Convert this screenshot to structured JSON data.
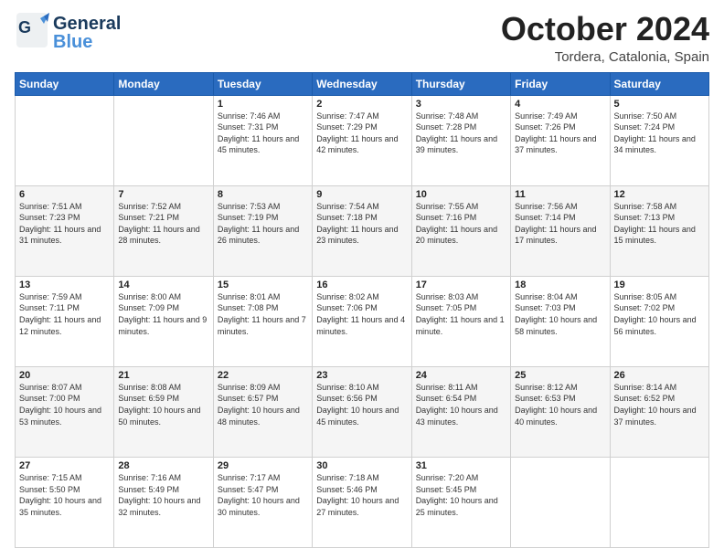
{
  "header": {
    "logo_general": "General",
    "logo_blue": "Blue",
    "month_title": "October 2024",
    "location": "Tordera, Catalonia, Spain"
  },
  "weekdays": [
    "Sunday",
    "Monday",
    "Tuesday",
    "Wednesday",
    "Thursday",
    "Friday",
    "Saturday"
  ],
  "weeks": [
    [
      {
        "day": "",
        "sunrise": "",
        "sunset": "",
        "daylight": ""
      },
      {
        "day": "",
        "sunrise": "",
        "sunset": "",
        "daylight": ""
      },
      {
        "day": "1",
        "sunrise": "Sunrise: 7:46 AM",
        "sunset": "Sunset: 7:31 PM",
        "daylight": "Daylight: 11 hours and 45 minutes."
      },
      {
        "day": "2",
        "sunrise": "Sunrise: 7:47 AM",
        "sunset": "Sunset: 7:29 PM",
        "daylight": "Daylight: 11 hours and 42 minutes."
      },
      {
        "day": "3",
        "sunrise": "Sunrise: 7:48 AM",
        "sunset": "Sunset: 7:28 PM",
        "daylight": "Daylight: 11 hours and 39 minutes."
      },
      {
        "day": "4",
        "sunrise": "Sunrise: 7:49 AM",
        "sunset": "Sunset: 7:26 PM",
        "daylight": "Daylight: 11 hours and 37 minutes."
      },
      {
        "day": "5",
        "sunrise": "Sunrise: 7:50 AM",
        "sunset": "Sunset: 7:24 PM",
        "daylight": "Daylight: 11 hours and 34 minutes."
      }
    ],
    [
      {
        "day": "6",
        "sunrise": "Sunrise: 7:51 AM",
        "sunset": "Sunset: 7:23 PM",
        "daylight": "Daylight: 11 hours and 31 minutes."
      },
      {
        "day": "7",
        "sunrise": "Sunrise: 7:52 AM",
        "sunset": "Sunset: 7:21 PM",
        "daylight": "Daylight: 11 hours and 28 minutes."
      },
      {
        "day": "8",
        "sunrise": "Sunrise: 7:53 AM",
        "sunset": "Sunset: 7:19 PM",
        "daylight": "Daylight: 11 hours and 26 minutes."
      },
      {
        "day": "9",
        "sunrise": "Sunrise: 7:54 AM",
        "sunset": "Sunset: 7:18 PM",
        "daylight": "Daylight: 11 hours and 23 minutes."
      },
      {
        "day": "10",
        "sunrise": "Sunrise: 7:55 AM",
        "sunset": "Sunset: 7:16 PM",
        "daylight": "Daylight: 11 hours and 20 minutes."
      },
      {
        "day": "11",
        "sunrise": "Sunrise: 7:56 AM",
        "sunset": "Sunset: 7:14 PM",
        "daylight": "Daylight: 11 hours and 17 minutes."
      },
      {
        "day": "12",
        "sunrise": "Sunrise: 7:58 AM",
        "sunset": "Sunset: 7:13 PM",
        "daylight": "Daylight: 11 hours and 15 minutes."
      }
    ],
    [
      {
        "day": "13",
        "sunrise": "Sunrise: 7:59 AM",
        "sunset": "Sunset: 7:11 PM",
        "daylight": "Daylight: 11 hours and 12 minutes."
      },
      {
        "day": "14",
        "sunrise": "Sunrise: 8:00 AM",
        "sunset": "Sunset: 7:09 PM",
        "daylight": "Daylight: 11 hours and 9 minutes."
      },
      {
        "day": "15",
        "sunrise": "Sunrise: 8:01 AM",
        "sunset": "Sunset: 7:08 PM",
        "daylight": "Daylight: 11 hours and 7 minutes."
      },
      {
        "day": "16",
        "sunrise": "Sunrise: 8:02 AM",
        "sunset": "Sunset: 7:06 PM",
        "daylight": "Daylight: 11 hours and 4 minutes."
      },
      {
        "day": "17",
        "sunrise": "Sunrise: 8:03 AM",
        "sunset": "Sunset: 7:05 PM",
        "daylight": "Daylight: 11 hours and 1 minute."
      },
      {
        "day": "18",
        "sunrise": "Sunrise: 8:04 AM",
        "sunset": "Sunset: 7:03 PM",
        "daylight": "Daylight: 10 hours and 58 minutes."
      },
      {
        "day": "19",
        "sunrise": "Sunrise: 8:05 AM",
        "sunset": "Sunset: 7:02 PM",
        "daylight": "Daylight: 10 hours and 56 minutes."
      }
    ],
    [
      {
        "day": "20",
        "sunrise": "Sunrise: 8:07 AM",
        "sunset": "Sunset: 7:00 PM",
        "daylight": "Daylight: 10 hours and 53 minutes."
      },
      {
        "day": "21",
        "sunrise": "Sunrise: 8:08 AM",
        "sunset": "Sunset: 6:59 PM",
        "daylight": "Daylight: 10 hours and 50 minutes."
      },
      {
        "day": "22",
        "sunrise": "Sunrise: 8:09 AM",
        "sunset": "Sunset: 6:57 PM",
        "daylight": "Daylight: 10 hours and 48 minutes."
      },
      {
        "day": "23",
        "sunrise": "Sunrise: 8:10 AM",
        "sunset": "Sunset: 6:56 PM",
        "daylight": "Daylight: 10 hours and 45 minutes."
      },
      {
        "day": "24",
        "sunrise": "Sunrise: 8:11 AM",
        "sunset": "Sunset: 6:54 PM",
        "daylight": "Daylight: 10 hours and 43 minutes."
      },
      {
        "day": "25",
        "sunrise": "Sunrise: 8:12 AM",
        "sunset": "Sunset: 6:53 PM",
        "daylight": "Daylight: 10 hours and 40 minutes."
      },
      {
        "day": "26",
        "sunrise": "Sunrise: 8:14 AM",
        "sunset": "Sunset: 6:52 PM",
        "daylight": "Daylight: 10 hours and 37 minutes."
      }
    ],
    [
      {
        "day": "27",
        "sunrise": "Sunrise: 7:15 AM",
        "sunset": "Sunset: 5:50 PM",
        "daylight": "Daylight: 10 hours and 35 minutes."
      },
      {
        "day": "28",
        "sunrise": "Sunrise: 7:16 AM",
        "sunset": "Sunset: 5:49 PM",
        "daylight": "Daylight: 10 hours and 32 minutes."
      },
      {
        "day": "29",
        "sunrise": "Sunrise: 7:17 AM",
        "sunset": "Sunset: 5:47 PM",
        "daylight": "Daylight: 10 hours and 30 minutes."
      },
      {
        "day": "30",
        "sunrise": "Sunrise: 7:18 AM",
        "sunset": "Sunset: 5:46 PM",
        "daylight": "Daylight: 10 hours and 27 minutes."
      },
      {
        "day": "31",
        "sunrise": "Sunrise: 7:20 AM",
        "sunset": "Sunset: 5:45 PM",
        "daylight": "Daylight: 10 hours and 25 minutes."
      },
      {
        "day": "",
        "sunrise": "",
        "sunset": "",
        "daylight": ""
      },
      {
        "day": "",
        "sunrise": "",
        "sunset": "",
        "daylight": ""
      }
    ]
  ]
}
